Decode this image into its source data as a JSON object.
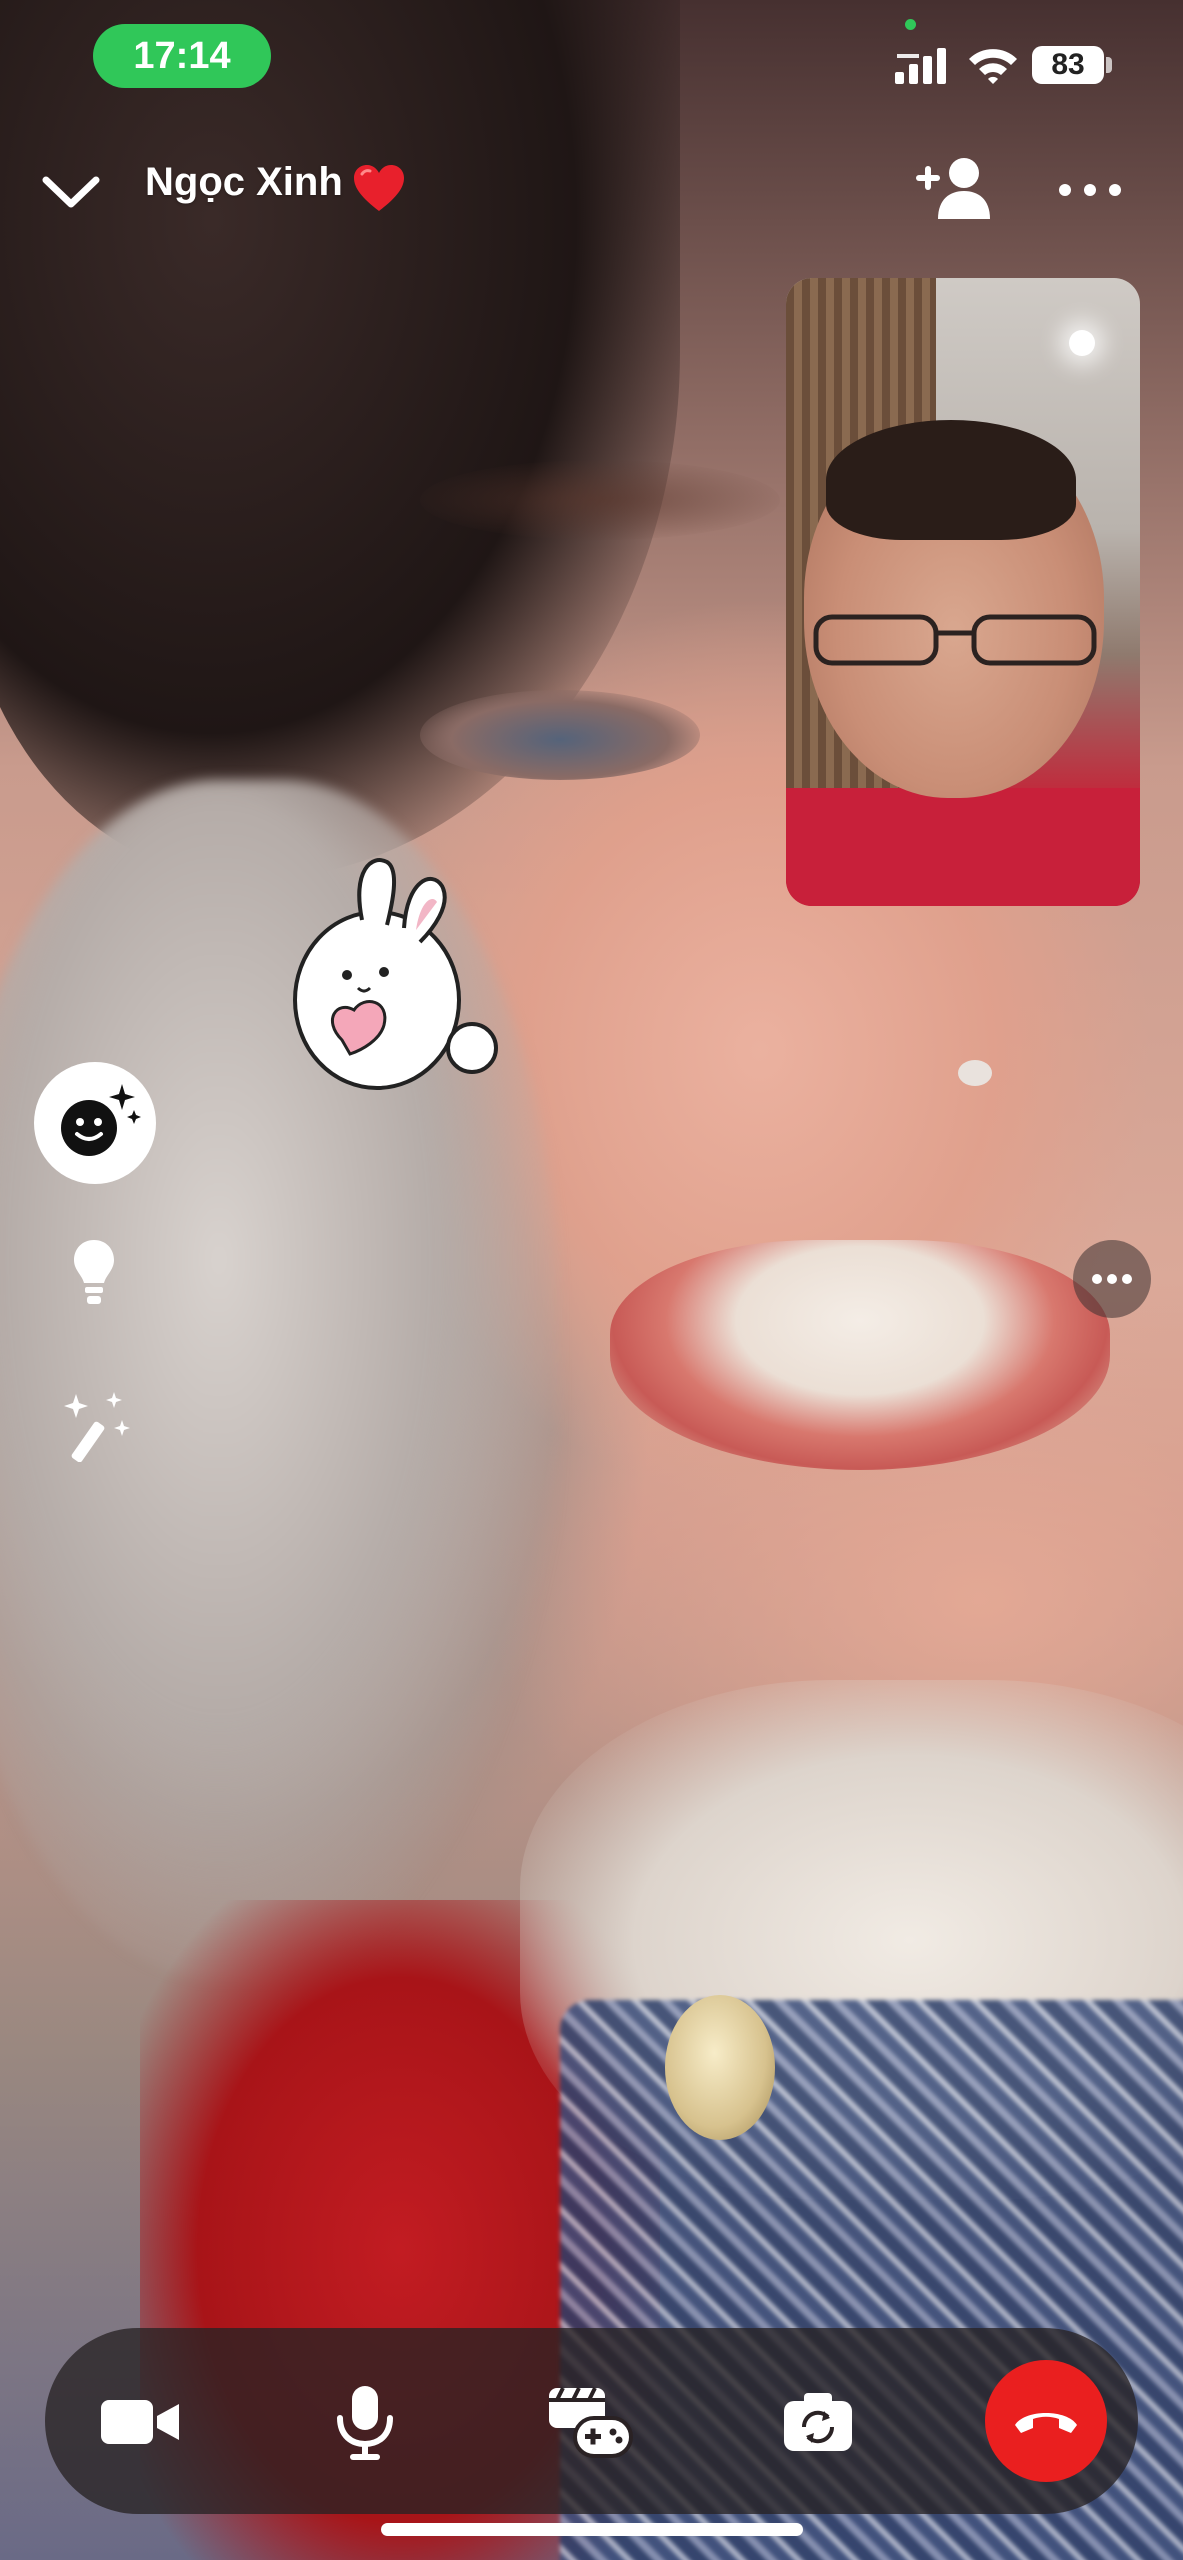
{
  "status_bar": {
    "time": "17:14",
    "battery": "83"
  },
  "header": {
    "contact_name": "Ngọc Xinh",
    "contact_emoji": "heart-emoji"
  },
  "icons": {
    "back": "chevron-down-icon",
    "add_person": "add-person-icon",
    "more": "more-horizontal-icon",
    "effects": "face-sparkle-icon",
    "bulb": "lightbulb-icon",
    "wand": "magic-wand-icon",
    "camera": "video-camera-icon",
    "mic": "microphone-icon",
    "games": "game-controller-icon",
    "flip": "flip-camera-icon",
    "end": "end-call-icon"
  },
  "colors": {
    "status_pill": "#30c759",
    "end_call": "#ea1f1f"
  }
}
